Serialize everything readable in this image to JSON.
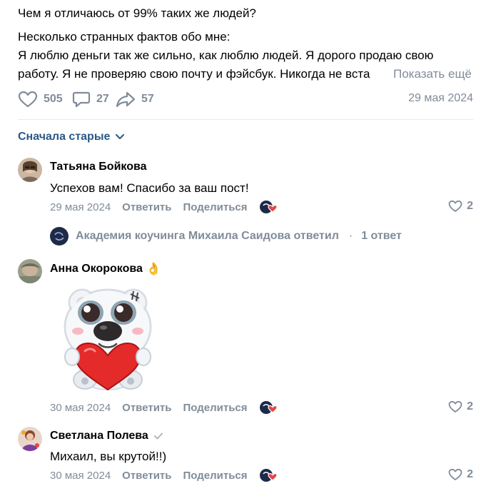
{
  "post": {
    "line1": "Чем я отличаюсь от 99% таких же людей?",
    "line2": "Несколько странных фактов обо мне:",
    "line3": "Я люблю деньги так же сильно, как люблю людей. Я дорого продаю свою",
    "line4": "работу. Я не проверяю свою почту и фэйсбук. Никогда не вста",
    "show_more": "Показать ещё",
    "likes": "505",
    "comments": "27",
    "shares": "57",
    "date": "29 мая 2024"
  },
  "sort": {
    "label": "Сначала старые"
  },
  "comments": [
    {
      "author": "Татьяна Бойкова",
      "text": "Успехов вам! Спасибо за ваш пост!",
      "date": "29 мая 2024",
      "reply": "Ответить",
      "share": "Поделиться",
      "likes": "2",
      "replies_info": {
        "author": "Академия коучинга Михаила Саидова ответил",
        "count": "1 ответ"
      }
    },
    {
      "author": "Анна Окорокова",
      "author_emoji": "👌",
      "sticker": "heart-bear-sticker",
      "date": "30 мая 2024",
      "reply": "Ответить",
      "share": "Поделиться",
      "likes": "2"
    },
    {
      "author": "Светлана Полева",
      "text": "Михаил, вы крутой!!)",
      "date": "30 мая 2024",
      "reply": "Ответить",
      "share": "Поделиться",
      "likes": "2"
    }
  ],
  "colors": {
    "link": "#2a5885",
    "muted": "#818c99",
    "heart": "#e64646",
    "divider": "#e7e8ec"
  }
}
